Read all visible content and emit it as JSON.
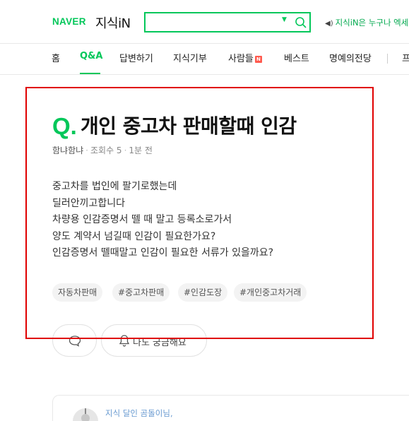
{
  "header": {
    "logo_naver": "NAVER",
    "logo_service": "지식iN",
    "search": {
      "value": "",
      "placeholder": ""
    },
    "notice": "지식iN은 누구나 엑세"
  },
  "gnb": {
    "items": [
      {
        "label": "홈",
        "active": false
      },
      {
        "label": "Q&A",
        "active": true
      },
      {
        "label": "답변하기",
        "active": false
      },
      {
        "label": "지식기부",
        "active": false
      },
      {
        "label": "사람들",
        "active": false,
        "badge": "N"
      },
      {
        "label": "베스트",
        "active": false
      },
      {
        "label": "명예의전당",
        "active": false
      },
      {
        "label": "프",
        "active": false
      }
    ]
  },
  "question": {
    "q_mark": "Q.",
    "title": "개인 중고차 판매할때 인감",
    "author": "함냐함냐",
    "views": "조회수 5",
    "time": "1분 전",
    "body": [
      "중고차를 법인에 팔기로했는데",
      "딜러안끼고합니다",
      "차량용 인감증명서 뗄 때 말고 등록소로가서",
      "양도 계약서 넘길때 인감이 필요한가요?",
      "인감증명서 뗄때말고 인감이 필요한 서류가 있을까요?"
    ],
    "tags": [
      "자동차판매",
      "#중고차판매",
      "#인감도장",
      "#개인중고차거래"
    ]
  },
  "actions": {
    "curious_label": "나도 궁금해요"
  },
  "answer": {
    "label": "지식 달인 곰돌이님,"
  },
  "colors": {
    "brand_green": "#03c75a",
    "highlight_red": "#e00000",
    "badge_red": "#ff5a4e"
  }
}
